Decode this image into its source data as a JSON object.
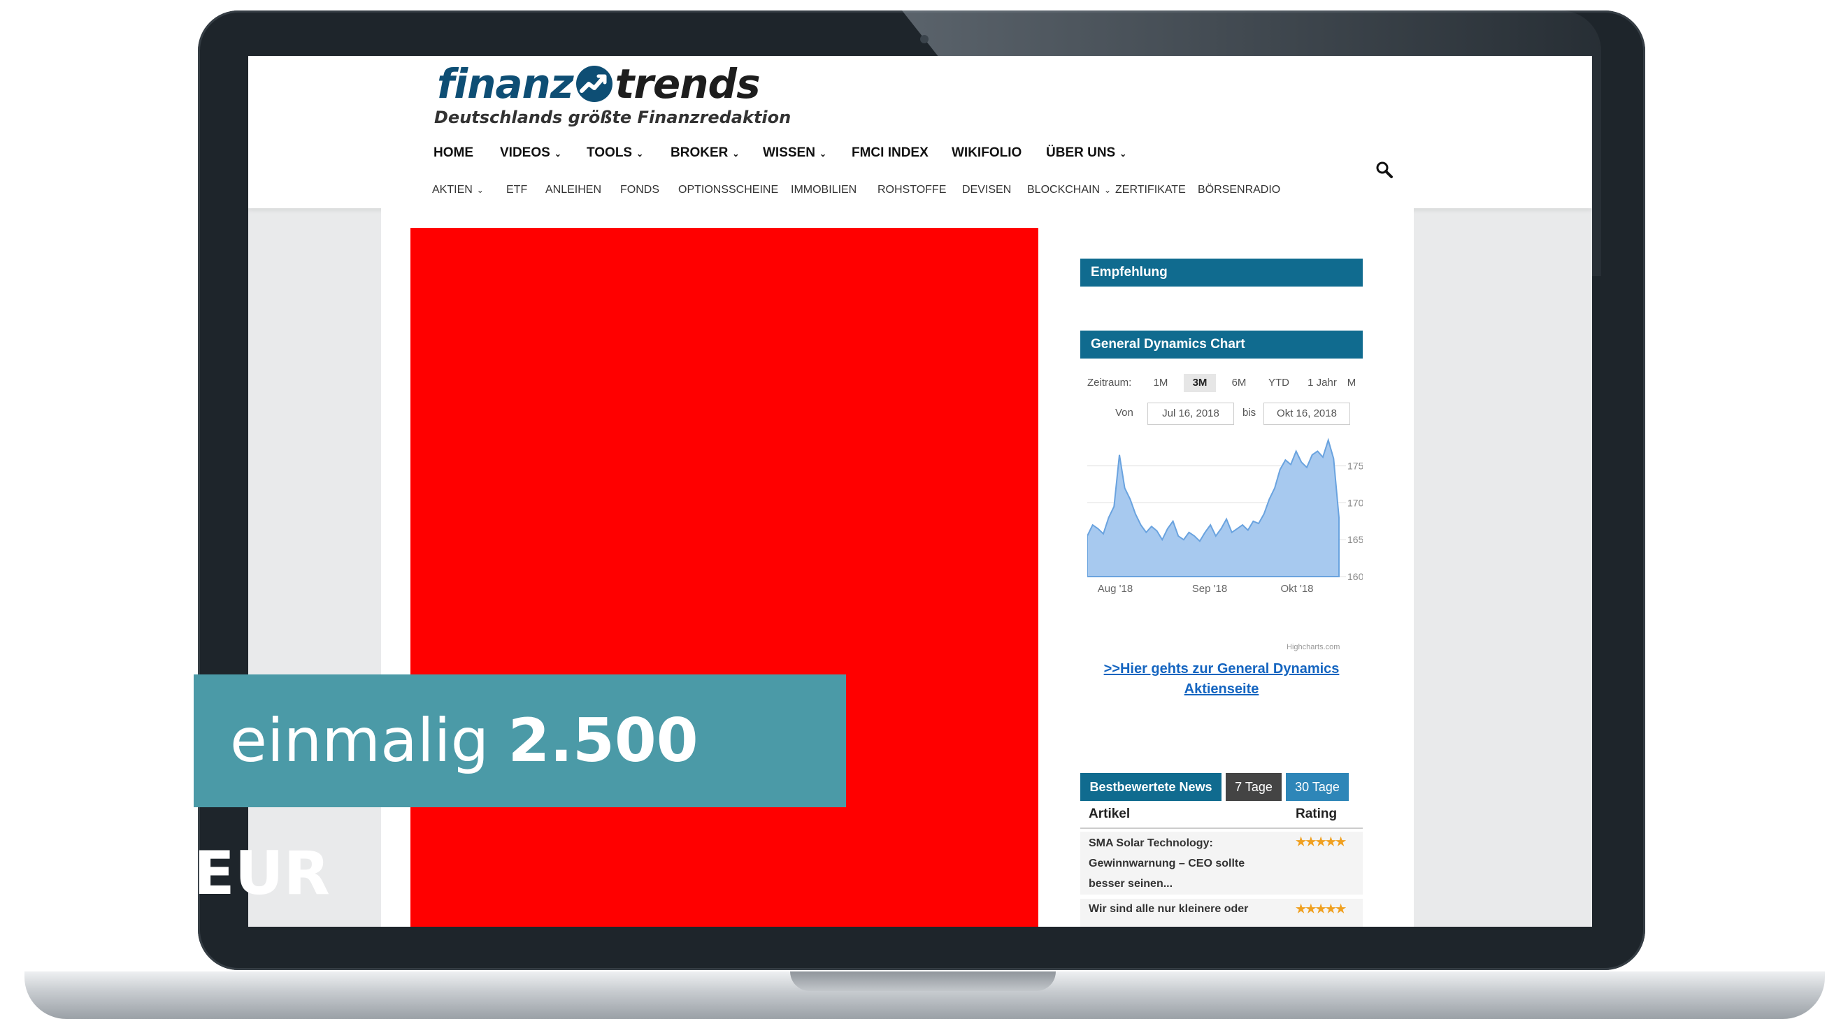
{
  "logo": {
    "part1": "finanz",
    "part2": "trends",
    "tagline": "Deutschlands größte Finanzredaktion"
  },
  "nav_primary": [
    "HOME",
    "VIDEOS",
    "TOOLS",
    "BROKER",
    "WISSEN",
    "FMCI INDEX",
    "WIKIFOLIO",
    "ÜBER UNS"
  ],
  "nav_secondary": [
    "AKTIEN",
    "ETF",
    "ANLEIHEN",
    "FONDS",
    "OPTIONSSCHEINE",
    "IMMOBILIEN",
    "ROHSTOFFE",
    "DEVISEN",
    "BLOCKCHAIN",
    "ZERTIFIKATE",
    "BÖRSENRADIO"
  ],
  "sidebar": {
    "empfehlung": "Empfehlung",
    "chart_title": "General Dynamics Chart",
    "zeitraum_label": "Zeitraum:",
    "ranges": [
      "1M",
      "3M",
      "6M",
      "YTD",
      "1 Jahr",
      "M"
    ],
    "active_range": "3M",
    "von_label": "Von",
    "von_value": "Jul 16, 2018",
    "bis_label": "bis",
    "bis_value": "Okt 16, 2018",
    "credit": "Highcharts.com",
    "link": ">>Hier gehts zur General Dynamics Aktienseite"
  },
  "chart_data": {
    "type": "area",
    "title": "General Dynamics Chart",
    "x_ticks": [
      "Aug '18",
      "Sep '18",
      "Okt '18"
    ],
    "y_ticks": [
      160,
      165,
      170,
      175
    ],
    "ylim": [
      160,
      178
    ],
    "series": [
      {
        "values": [
          165.5,
          167.0,
          166.5,
          165.8,
          168.0,
          169.5,
          176.5,
          172.0,
          170.5,
          168.5,
          167.0,
          166.0,
          166.8,
          166.2,
          165.0,
          166.5,
          167.5,
          165.5,
          165.0,
          166.0,
          165.5,
          164.8,
          166.0,
          167.0,
          165.5,
          166.5,
          167.8,
          166.0,
          166.5,
          167.0,
          166.3,
          167.5,
          167.2,
          168.5,
          170.5,
          172.0,
          174.5,
          175.8,
          175.2,
          177.0,
          175.5,
          174.8,
          176.5,
          177.0,
          176.2,
          178.5,
          176.0,
          168.0
        ]
      }
    ],
    "color": "#7cb5ec",
    "grid": true
  },
  "news": {
    "tab_label": "Bestbewertete News",
    "tab_7": "7 Tage",
    "tab_30": "30 Tage",
    "col_artikel": "Artikel",
    "col_rating": "Rating",
    "items": [
      {
        "title": "SMA Solar Technology: Gewinnwarnung – CEO sollte besser seinen...",
        "stars": "★★★★★"
      },
      {
        "title": "Wir sind alle nur kleinere oder",
        "stars": "★★★★★"
      }
    ]
  },
  "banner": {
    "prefix": "einmalig",
    "amount": "2.500 EUR"
  }
}
